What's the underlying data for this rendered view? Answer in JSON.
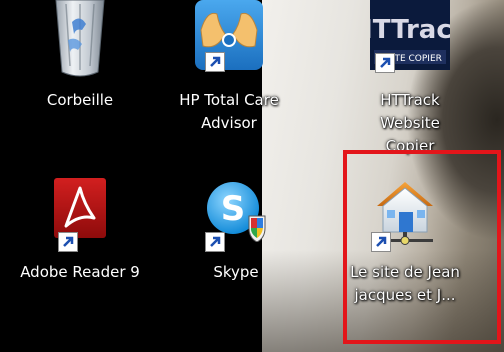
{
  "desktop": {
    "icons": [
      {
        "label": "Corbeille",
        "shortcut": false
      },
      {
        "label": "HP Total Care\nAdvisor",
        "shortcut": true
      },
      {
        "label": "HTTrack Website\nCopier",
        "shortcut": true
      },
      {
        "label": "Adobe Reader 9",
        "shortcut": true
      },
      {
        "label": "Skype",
        "shortcut": true
      },
      {
        "label": "Le site de Jean\njacques et J...",
        "shortcut": true,
        "highlighted": true
      }
    ],
    "httrack_logo_text": "HTTrack",
    "httrack_logo_subtext": "SITE COPIER"
  },
  "colors": {
    "highlight_border": "#e3151a",
    "desktop_background": "#000000"
  }
}
